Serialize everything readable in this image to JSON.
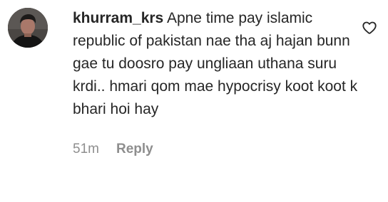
{
  "comment": {
    "username": "khurram_krs",
    "text": "Apne time pay islamic republic of pakistan nae tha aj hajan bunn gae tu doosro pay ungliaan uthana suru krdi.. hmari qom mae hypocrisy koot koot k bhari hoi hay",
    "time": "51m",
    "reply_label": "Reply",
    "avatar_icon": "profile-photo",
    "like_icon": "heart-outline-icon"
  },
  "colors": {
    "text": "#262626",
    "secondary": "#8e8e8e",
    "background": "#ffffff"
  }
}
